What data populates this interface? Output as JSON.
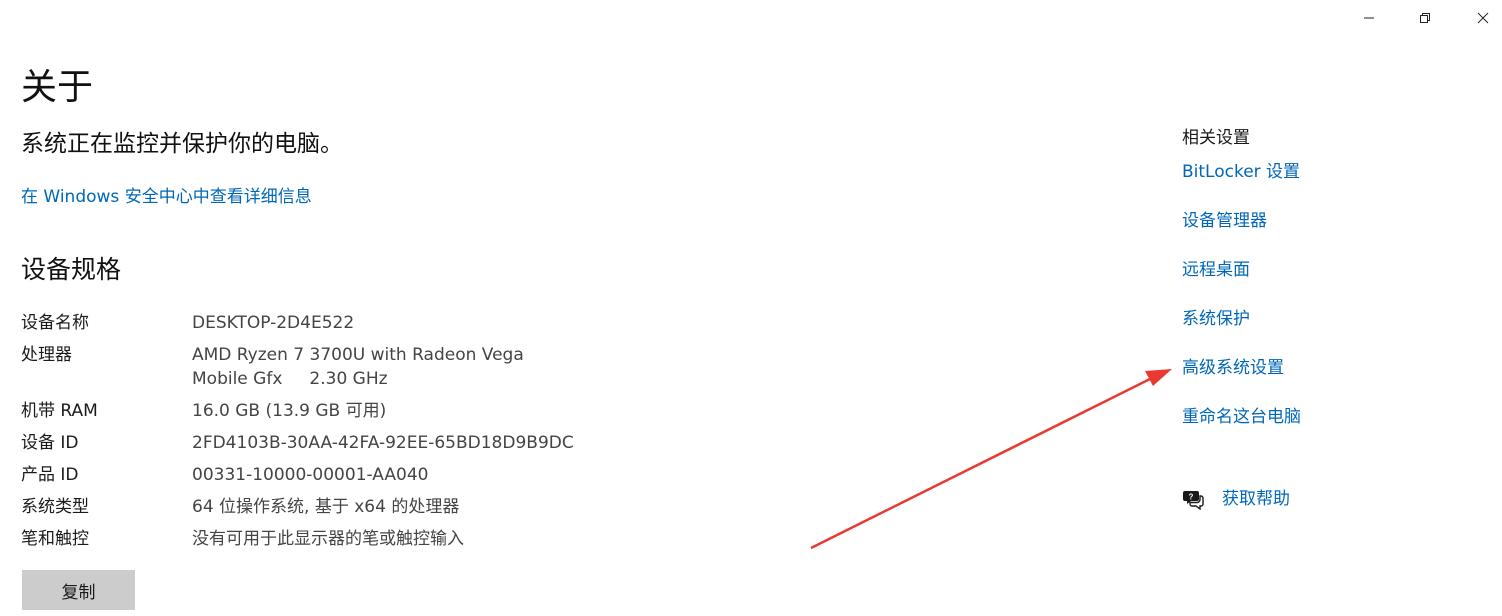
{
  "window_controls": {
    "minimize_icon": "minimize-icon",
    "restore_icon": "restore-icon",
    "close_icon": "close-icon"
  },
  "page": {
    "title": "关于",
    "status": "系统正在监控并保护你的电脑。",
    "security_link": "在 Windows 安全中心中查看详细信息"
  },
  "specs": {
    "title": "设备规格",
    "rows": [
      {
        "label": "设备名称",
        "value": "DESKTOP-2D4E522"
      },
      {
        "label": "处理器",
        "value": "AMD Ryzen 7 3700U with Radeon Vega Mobile Gfx     2.30 GHz"
      },
      {
        "label": "机带 RAM",
        "value": "16.0 GB (13.9 GB 可用)"
      },
      {
        "label": "设备 ID",
        "value": "2FD4103B-30AA-42FA-92EE-65BD18D9B9DC"
      },
      {
        "label": "产品 ID",
        "value": "00331-10000-00001-AA040"
      },
      {
        "label": "系统类型",
        "value": "64 位操作系统, 基于 x64 的处理器"
      },
      {
        "label": "笔和触控",
        "value": "没有可用于此显示器的笔或触控输入"
      }
    ],
    "copy_label": "复制"
  },
  "related": {
    "title": "相关设置",
    "links": [
      {
        "label": "BitLocker 设置"
      },
      {
        "label": "设备管理器"
      },
      {
        "label": "远程桌面"
      },
      {
        "label": "系统保护"
      },
      {
        "label": "高级系统设置"
      },
      {
        "label": "重命名这台电脑"
      }
    ]
  },
  "help": {
    "label": "获取帮助",
    "icon": "chat-help-icon"
  },
  "colors": {
    "link": "#0067b8",
    "annotation_arrow": "#e83a30",
    "button_bg": "#cccccc"
  }
}
